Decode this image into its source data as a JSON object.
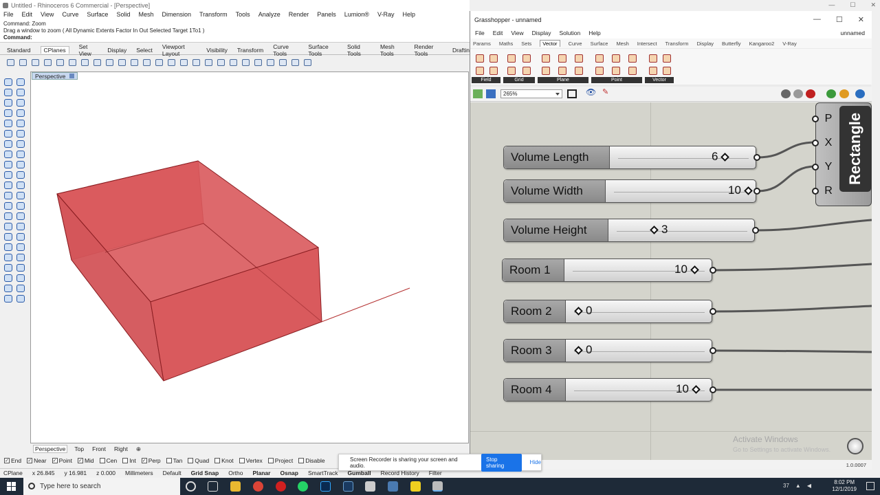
{
  "rhino": {
    "title": "Untitled - Rhinoceros 6 Commercial - [Perspective]",
    "menu": [
      "File",
      "Edit",
      "View",
      "Curve",
      "Surface",
      "Solid",
      "Mesh",
      "Dimension",
      "Transform",
      "Tools",
      "Analyze",
      "Render",
      "Panels",
      "Lumion®",
      "V-Ray",
      "Help"
    ],
    "command_history": [
      "Command: Zoom",
      "Drag a window to zoom ( All  Dynamic  Extents  Factor  In  Out  Selected  Target  1To1 )"
    ],
    "command_prompt": "Command:",
    "toolbar_tabs": [
      "Standard",
      "CPlanes",
      "Set View",
      "Display",
      "Select",
      "Viewport Layout",
      "Visibility",
      "Transform",
      "Curve Tools",
      "Surface Tools",
      "Solid Tools",
      "Mesh Tools",
      "Render Tools",
      "Draftin"
    ],
    "active_toolbar_tab": "CPlanes",
    "viewport_label": "Perspective",
    "viewport_tabs": [
      "Perspective",
      "Top",
      "Front",
      "Right"
    ],
    "active_viewport_tab": "Perspective",
    "osnaps": [
      {
        "label": "End",
        "checked": true
      },
      {
        "label": "Near",
        "checked": true
      },
      {
        "label": "Point",
        "checked": true
      },
      {
        "label": "Mid",
        "checked": true
      },
      {
        "label": "Cen",
        "checked": false
      },
      {
        "label": "Int",
        "checked": false
      },
      {
        "label": "Perp",
        "checked": true
      },
      {
        "label": "Tan",
        "checked": false
      },
      {
        "label": "Quad",
        "checked": false
      },
      {
        "label": "Knot",
        "checked": false
      },
      {
        "label": "Vertex",
        "checked": false
      },
      {
        "label": "Project",
        "checked": false
      },
      {
        "label": "Disable",
        "checked": false
      }
    ],
    "status": {
      "cplane": "CPlane",
      "x": "x 26.845",
      "y": "y 16.981",
      "z": "z 0.000",
      "units": "Millimeters",
      "layer": "Default",
      "grid_snap": "Grid Snap",
      "ortho": "Ortho",
      "planar": "Planar",
      "osnap": "Osnap",
      "smarttrack": "SmartTrack",
      "gumball": "Gumball",
      "history": "Record History",
      "filter": "Filter"
    },
    "box_color": "#d9595c"
  },
  "gh": {
    "title": "Grasshopper - unnamed",
    "doc_name": "unnamed",
    "menu": [
      "File",
      "Edit",
      "View",
      "Display",
      "Solution",
      "Help"
    ],
    "tabs": [
      "Params",
      "Maths",
      "Sets",
      "Vector",
      "Curve",
      "Surface",
      "Mesh",
      "Intersect",
      "Transform",
      "Display",
      "Butterfly",
      "Kangaroo2",
      "V-Ray"
    ],
    "active_tab": "Vector",
    "ribbon_groups": [
      "Field",
      "Grid",
      "Plane",
      "Point",
      "Vector"
    ],
    "zoom": "265%",
    "sliders": [
      {
        "label": "Volume Length",
        "value": "6",
        "fraction": 0.55
      },
      {
        "label": "Volume Width",
        "value": "10",
        "fraction": 1.0
      },
      {
        "label": "Volume Height",
        "value": "3",
        "fraction": 0.3
      },
      {
        "label": "Room 1",
        "value": "10",
        "fraction": 1.0
      },
      {
        "label": "Room 2",
        "value": "0",
        "fraction": 0.0
      },
      {
        "label": "Room 3",
        "value": "0",
        "fraction": 0.0
      },
      {
        "label": "Room 4",
        "value": "10",
        "fraction": 1.0
      }
    ],
    "component": {
      "name": "Rectangle",
      "inputs": [
        "P",
        "X",
        "Y",
        "R"
      ]
    },
    "watermark": "Activate Windows",
    "watermark_sub": "Go to Settings to activate Windows.",
    "version": "1.0.0007"
  },
  "recorder": {
    "message": "Screen Recorder is sharing your screen and audio.",
    "stop": "Stop sharing",
    "hide": "Hide"
  },
  "taskbar": {
    "search_placeholder": "Type here to search",
    "time": "8:02 PM",
    "date": "12/1/2019",
    "temp": "37"
  }
}
